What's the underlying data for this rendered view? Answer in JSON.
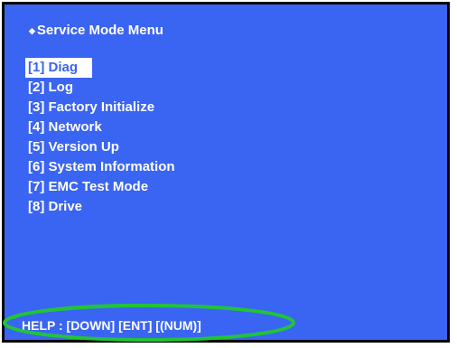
{
  "screen": {
    "title": "Service Mode Menu",
    "title_bullet": "◆",
    "background_color": "#3a64f2",
    "text_color": "#ffffff",
    "border_color": "#000000"
  },
  "menu": {
    "selected_index": 0,
    "items": [
      {
        "label": "[1] Diag"
      },
      {
        "label": "[2] Log"
      },
      {
        "label": "[3] Factory Initialize"
      },
      {
        "label": "[4] Network"
      },
      {
        "label": "[5] Version Up"
      },
      {
        "label": "[6] System Information"
      },
      {
        "label": "[7] EMC Test Mode"
      },
      {
        "label": "[8] Drive"
      }
    ]
  },
  "help": {
    "text": "HELP : [DOWN] [ENT] [(NUM)]",
    "annotation_color": "#22c33a"
  }
}
